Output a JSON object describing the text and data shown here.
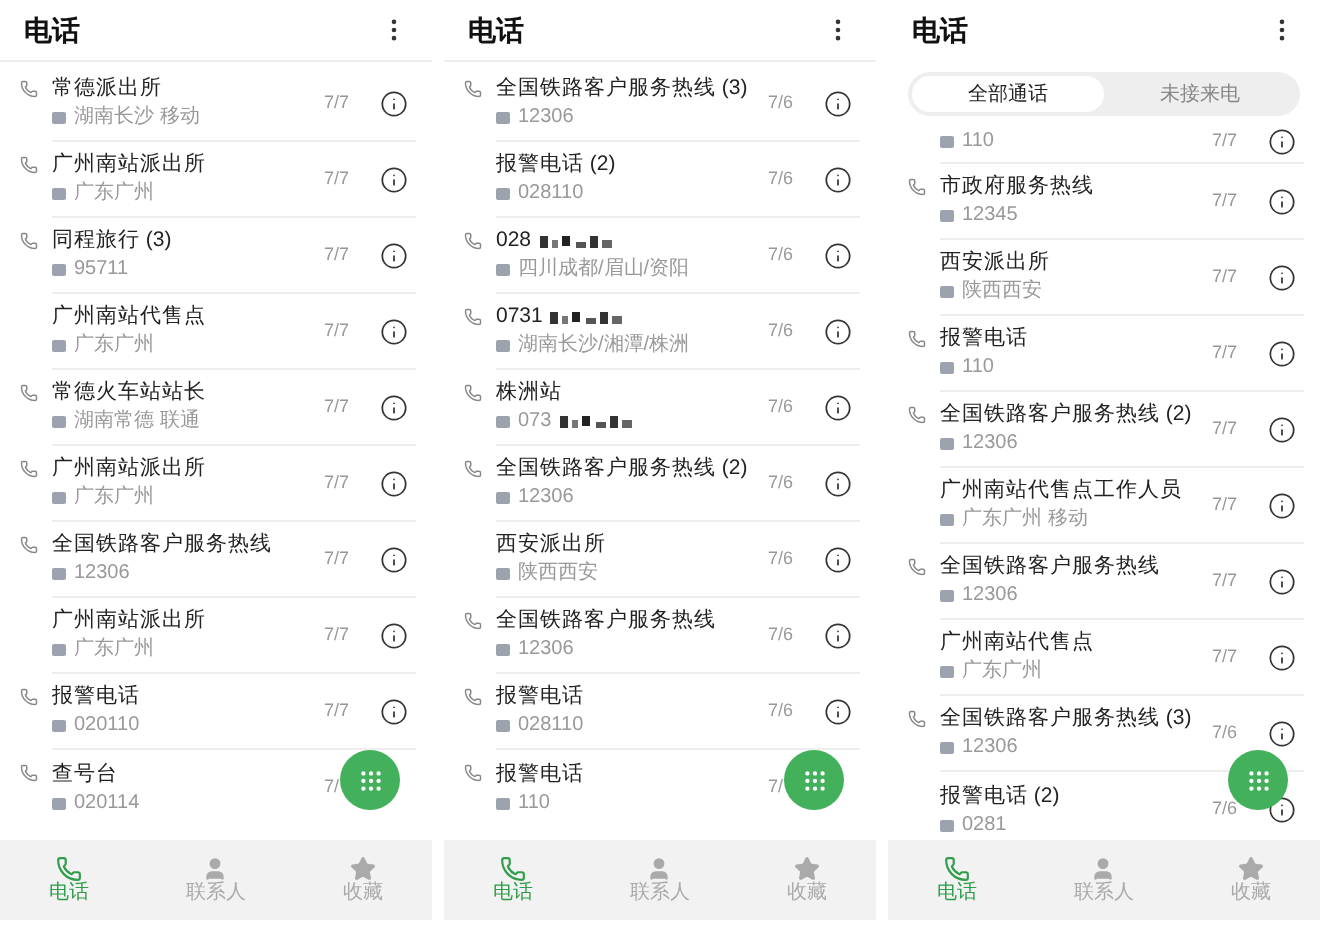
{
  "screens": [
    {
      "title": "电话",
      "calls": [
        {
          "name": "常德派出所",
          "sub": "湖南长沙 移动",
          "date": "7/7",
          "call_icon": true,
          "info": true
        },
        {
          "name": "广州南站派出所",
          "sub": "广东广州",
          "date": "7/7",
          "call_icon": true,
          "info": true
        },
        {
          "name": "同程旅行 (3)",
          "sub": "95711",
          "date": "7/7",
          "call_icon": true,
          "info": true
        },
        {
          "name": "广州南站代售点",
          "sub": "广东广州",
          "date": "7/7",
          "call_icon": false,
          "info": true
        },
        {
          "name": "常德火车站站长",
          "sub": "湖南常德 联通",
          "date": "7/7",
          "call_icon": true,
          "info": true
        },
        {
          "name": "广州南站派出所",
          "sub": "广东广州",
          "date": "7/7",
          "call_icon": true,
          "info": true
        },
        {
          "name": "全国铁路客户服务热线",
          "sub": "12306",
          "date": "7/7",
          "call_icon": true,
          "info": true
        },
        {
          "name": "广州南站派出所",
          "sub": "广东广州",
          "date": "7/7",
          "call_icon": false,
          "info": true
        },
        {
          "name": "报警电话",
          "sub": "020110",
          "date": "7/7",
          "call_icon": true,
          "info": true
        },
        {
          "name": "查号台",
          "sub": "020114",
          "date": "7/",
          "call_icon": true,
          "info": false
        }
      ],
      "nav": [
        {
          "label": "电话",
          "selected": true
        },
        {
          "label": "联系人",
          "selected": false
        },
        {
          "label": "收藏",
          "selected": false
        }
      ]
    },
    {
      "title": "电话",
      "calls": [
        {
          "name": "全国铁路客户服务热线 (3)",
          "sub": "12306",
          "date": "7/6",
          "call_icon": true,
          "info": true
        },
        {
          "name": "报警电话 (2)",
          "sub": "028110",
          "date": "7/6",
          "call_icon": false,
          "info": true
        },
        {
          "name": "028",
          "sub": "四川成都/眉山/资阳",
          "date": "7/6",
          "call_icon": true,
          "info": true,
          "kind": "masked_name"
        },
        {
          "name": "0731",
          "sub": "湖南长沙/湘潭/株洲",
          "date": "7/6",
          "call_icon": true,
          "info": true,
          "kind": "masked_name"
        },
        {
          "name": "株洲站",
          "sub": "073",
          "date": "7/6",
          "call_icon": true,
          "info": true,
          "kind": "masked_sub"
        },
        {
          "name": "全国铁路客户服务热线 (2)",
          "sub": "12306",
          "date": "7/6",
          "call_icon": true,
          "info": true
        },
        {
          "name": "西安派出所",
          "sub": "陕西西安",
          "date": "7/6",
          "call_icon": false,
          "info": true
        },
        {
          "name": "全国铁路客户服务热线",
          "sub": "12306",
          "date": "7/6",
          "call_icon": true,
          "info": true
        },
        {
          "name": "报警电话",
          "sub": "028110",
          "date": "7/6",
          "call_icon": true,
          "info": true
        },
        {
          "name": "报警电话",
          "sub": "110",
          "date": "7/",
          "call_icon": true,
          "info": false
        }
      ],
      "nav": [
        {
          "label": "电话",
          "selected": true
        },
        {
          "label": "联系人",
          "selected": false
        },
        {
          "label": "收藏",
          "selected": false
        }
      ]
    },
    {
      "title": "电话",
      "tabs": [
        {
          "label": "全部通话",
          "selected": true
        },
        {
          "label": "未接来电",
          "selected": false
        }
      ],
      "calls": [
        {
          "sub": "110",
          "date": "7/7",
          "call_icon": false,
          "info": true,
          "kind": "partial"
        },
        {
          "name": "市政府服务热线",
          "sub": "12345",
          "date": "7/7",
          "call_icon": true,
          "info": true
        },
        {
          "name": "西安派出所",
          "sub": "陕西西安",
          "date": "7/7",
          "call_icon": false,
          "info": true
        },
        {
          "name": "报警电话",
          "sub": "110",
          "date": "7/7",
          "call_icon": true,
          "info": true
        },
        {
          "name": "全国铁路客户服务热线 (2)",
          "sub": "12306",
          "date": "7/7",
          "call_icon": true,
          "info": true
        },
        {
          "name": "广州南站代售点工作人员",
          "sub": "广东广州 移动",
          "date": "7/7",
          "call_icon": false,
          "info": true
        },
        {
          "name": "全国铁路客户服务热线",
          "sub": "12306",
          "date": "7/7",
          "call_icon": true,
          "info": true
        },
        {
          "name": "广州南站代售点",
          "sub": "广东广州",
          "date": "7/7",
          "call_icon": false,
          "info": true
        },
        {
          "name": "全国铁路客户服务热线 (3)",
          "sub": "12306",
          "date": "7/6",
          "call_icon": true,
          "info": true
        },
        {
          "name": "报警电话 (2)",
          "sub": "0281",
          "date": "7/6",
          "call_icon": false,
          "info": true
        }
      ],
      "nav": [
        {
          "label": "电话",
          "selected": true
        },
        {
          "label": "联系人",
          "selected": false
        },
        {
          "label": "收藏",
          "selected": false
        }
      ]
    }
  ]
}
